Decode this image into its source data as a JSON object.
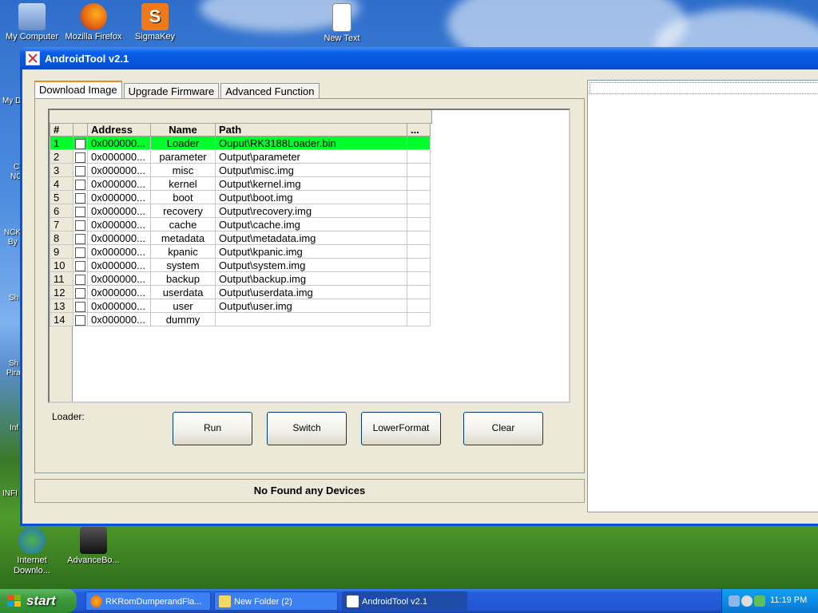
{
  "desktop": {
    "icons": [
      {
        "label": "My Computer"
      },
      {
        "label": "Mozilla Firefox"
      },
      {
        "label": "SigmaKey"
      },
      {
        "label": "New Text Document"
      },
      {
        "label": "Internet Downlo..."
      },
      {
        "label": "AdvanceBo..."
      }
    ],
    "left_fragments": [
      "My D",
      "C",
      "NC",
      "NCK",
      "By",
      "Sh",
      "Sh",
      "Pira",
      "Inf",
      "INFI"
    ]
  },
  "window": {
    "title": "AndroidTool v2.1",
    "tabs": [
      "Download Image",
      "Upgrade Firmware",
      "Advanced Function"
    ],
    "table": {
      "columns": [
        "#",
        "",
        "Address",
        "Name",
        "Path",
        "..."
      ],
      "rows": [
        {
          "num": "1",
          "address": "0x000000...",
          "name": "Loader",
          "path": "Ouput\\RK3188Loader.bin"
        },
        {
          "num": "2",
          "address": "0x000000...",
          "name": "parameter",
          "path": "Output\\parameter"
        },
        {
          "num": "3",
          "address": "0x000000...",
          "name": "misc",
          "path": "Output\\misc.img"
        },
        {
          "num": "4",
          "address": "0x000000...",
          "name": "kernel",
          "path": "Output\\kernel.img"
        },
        {
          "num": "5",
          "address": "0x000000...",
          "name": "boot",
          "path": "Output\\boot.img"
        },
        {
          "num": "6",
          "address": "0x000000...",
          "name": "recovery",
          "path": "Output\\recovery.img"
        },
        {
          "num": "7",
          "address": "0x000000...",
          "name": "cache",
          "path": "Output\\cache.img"
        },
        {
          "num": "8",
          "address": "0x000000...",
          "name": "metadata",
          "path": "Output\\metadata.img"
        },
        {
          "num": "9",
          "address": "0x000000...",
          "name": "kpanic",
          "path": "Output\\kpanic.img"
        },
        {
          "num": "10",
          "address": "0x000000...",
          "name": "system",
          "path": "Output\\system.img"
        },
        {
          "num": "11",
          "address": "0x000000...",
          "name": "backup",
          "path": "Output\\backup.img"
        },
        {
          "num": "12",
          "address": "0x000000...",
          "name": "userdata",
          "path": "Output\\userdata.img"
        },
        {
          "num": "13",
          "address": "0x000000...",
          "name": "user",
          "path": "Output\\user.img"
        },
        {
          "num": "14",
          "address": "0x000000...",
          "name": "dummy",
          "path": ""
        }
      ],
      "selected_color": "#00ff2a"
    },
    "loader_label": "Loader:",
    "buttons": {
      "run": "Run",
      "switch": "Switch",
      "lowerformat": "LowerFormat",
      "clear": "Clear"
    },
    "status": "No Found any Devices"
  },
  "taskbar": {
    "start_label": "start",
    "tasks": [
      "RKRomDumperandFla...",
      "New Folder (2)",
      "AndroidTool v2.1"
    ],
    "clock": "11:19 PM"
  }
}
